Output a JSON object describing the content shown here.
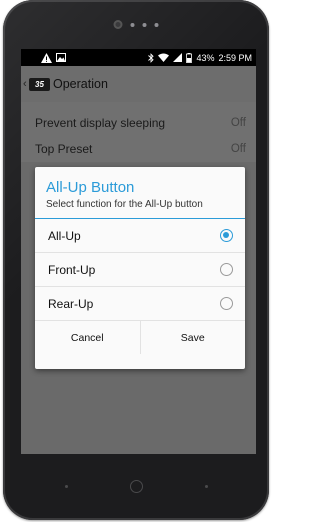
{
  "status_bar": {
    "battery": "43%",
    "time": "2:59 PM"
  },
  "app_bar": {
    "logo_text": "35",
    "title": "Operation"
  },
  "settings": [
    {
      "label": "Prevent display sleeping",
      "value": "Off"
    },
    {
      "label": "Top Preset",
      "value": "Off"
    }
  ],
  "dialog": {
    "title": "All-Up Button",
    "subtitle": "Select function for the All-Up button",
    "options": [
      {
        "label": "All-Up",
        "selected": true
      },
      {
        "label": "Front-Up",
        "selected": false
      },
      {
        "label": "Rear-Up",
        "selected": false
      }
    ],
    "cancel_label": "Cancel",
    "save_label": "Save"
  },
  "colors": {
    "accent": "#2b9bd8"
  }
}
